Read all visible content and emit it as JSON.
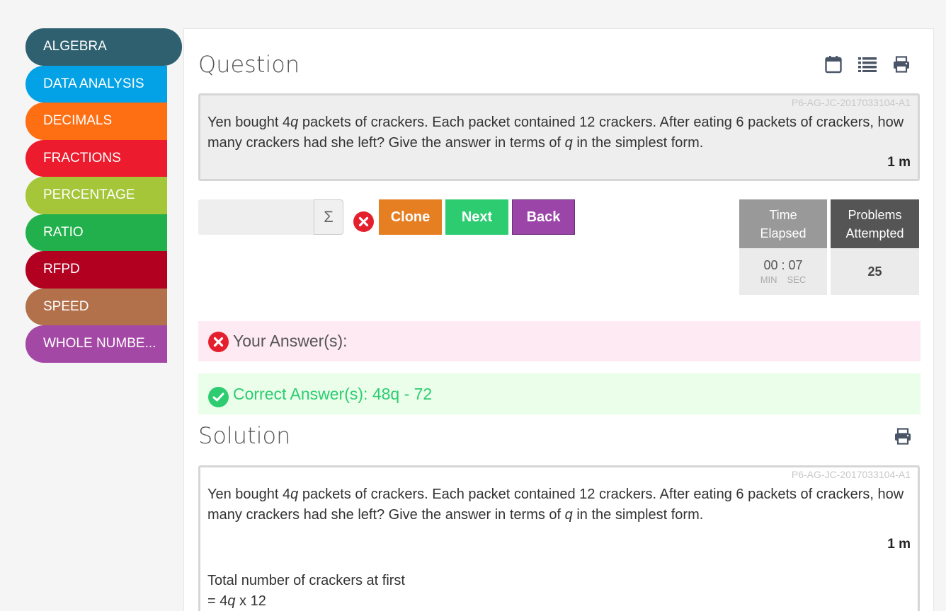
{
  "sidebar": {
    "items": [
      {
        "label": "ALGEBRA",
        "color": "#2e6070"
      },
      {
        "label": "DATA ANALYSIS",
        "color": "#03a1e6"
      },
      {
        "label": "DECIMALS",
        "color": "#fe6e12"
      },
      {
        "label": "FRACTIONS",
        "color": "#ec1c2e"
      },
      {
        "label": "PERCENTAGE",
        "color": "#a6c639"
      },
      {
        "label": "RATIO",
        "color": "#22b04c"
      },
      {
        "label": "RFPD",
        "color": "#b20021"
      },
      {
        "label": "SPEED",
        "color": "#b2714b"
      },
      {
        "label": "WHOLE NUMBE...",
        "color": "#a448a5"
      }
    ]
  },
  "question": {
    "title": "Question",
    "id": "P6-AG-JC-2017033104-A1",
    "text_before_1": "Yen bought 4",
    "var": "q",
    "text_after_1": " packets of crackers. Each packet contained 12 crackers. After eating 6 packets of crackers, how many crackers had she left? Give the answer in terms of ",
    "text_after_2": " in the simplest form.",
    "marks": "1 m",
    "icons": [
      "calendar-icon",
      "list-icon",
      "print-icon"
    ]
  },
  "answer": {
    "input_value": "",
    "sigma": "Σ",
    "clone_label": "Clone",
    "next_label": "Next",
    "back_label": "Back"
  },
  "stats": {
    "time_label_1": "Time",
    "time_label_2": "Elapsed",
    "time_value": "00 : 07",
    "min_label": "MIN",
    "sec_label": "SEC",
    "problems_label_1": "Problems",
    "problems_label_2": "Attempted",
    "problems_value": "25"
  },
  "results": {
    "your_answer": "Your Answer(s):",
    "correct_answer": "Correct Answer(s): 48q - 72"
  },
  "solution": {
    "title": "Solution",
    "id": "P6-AG-JC-2017033104-A1",
    "marks": "1 m",
    "step1": "Total number of crackers at first",
    "step2_prefix": "= 4",
    "step2_var": "q",
    "step2_suffix": " x 12"
  },
  "colors": {
    "clone": "#e67e22",
    "next": "#2ecc71",
    "back": "#9b45a8",
    "time_head": "#999999",
    "problems_head": "#555555",
    "wrong_bg": "#fdeaf2",
    "correct_bg": "#eafeea",
    "correct_text": "#2ecc71"
  }
}
